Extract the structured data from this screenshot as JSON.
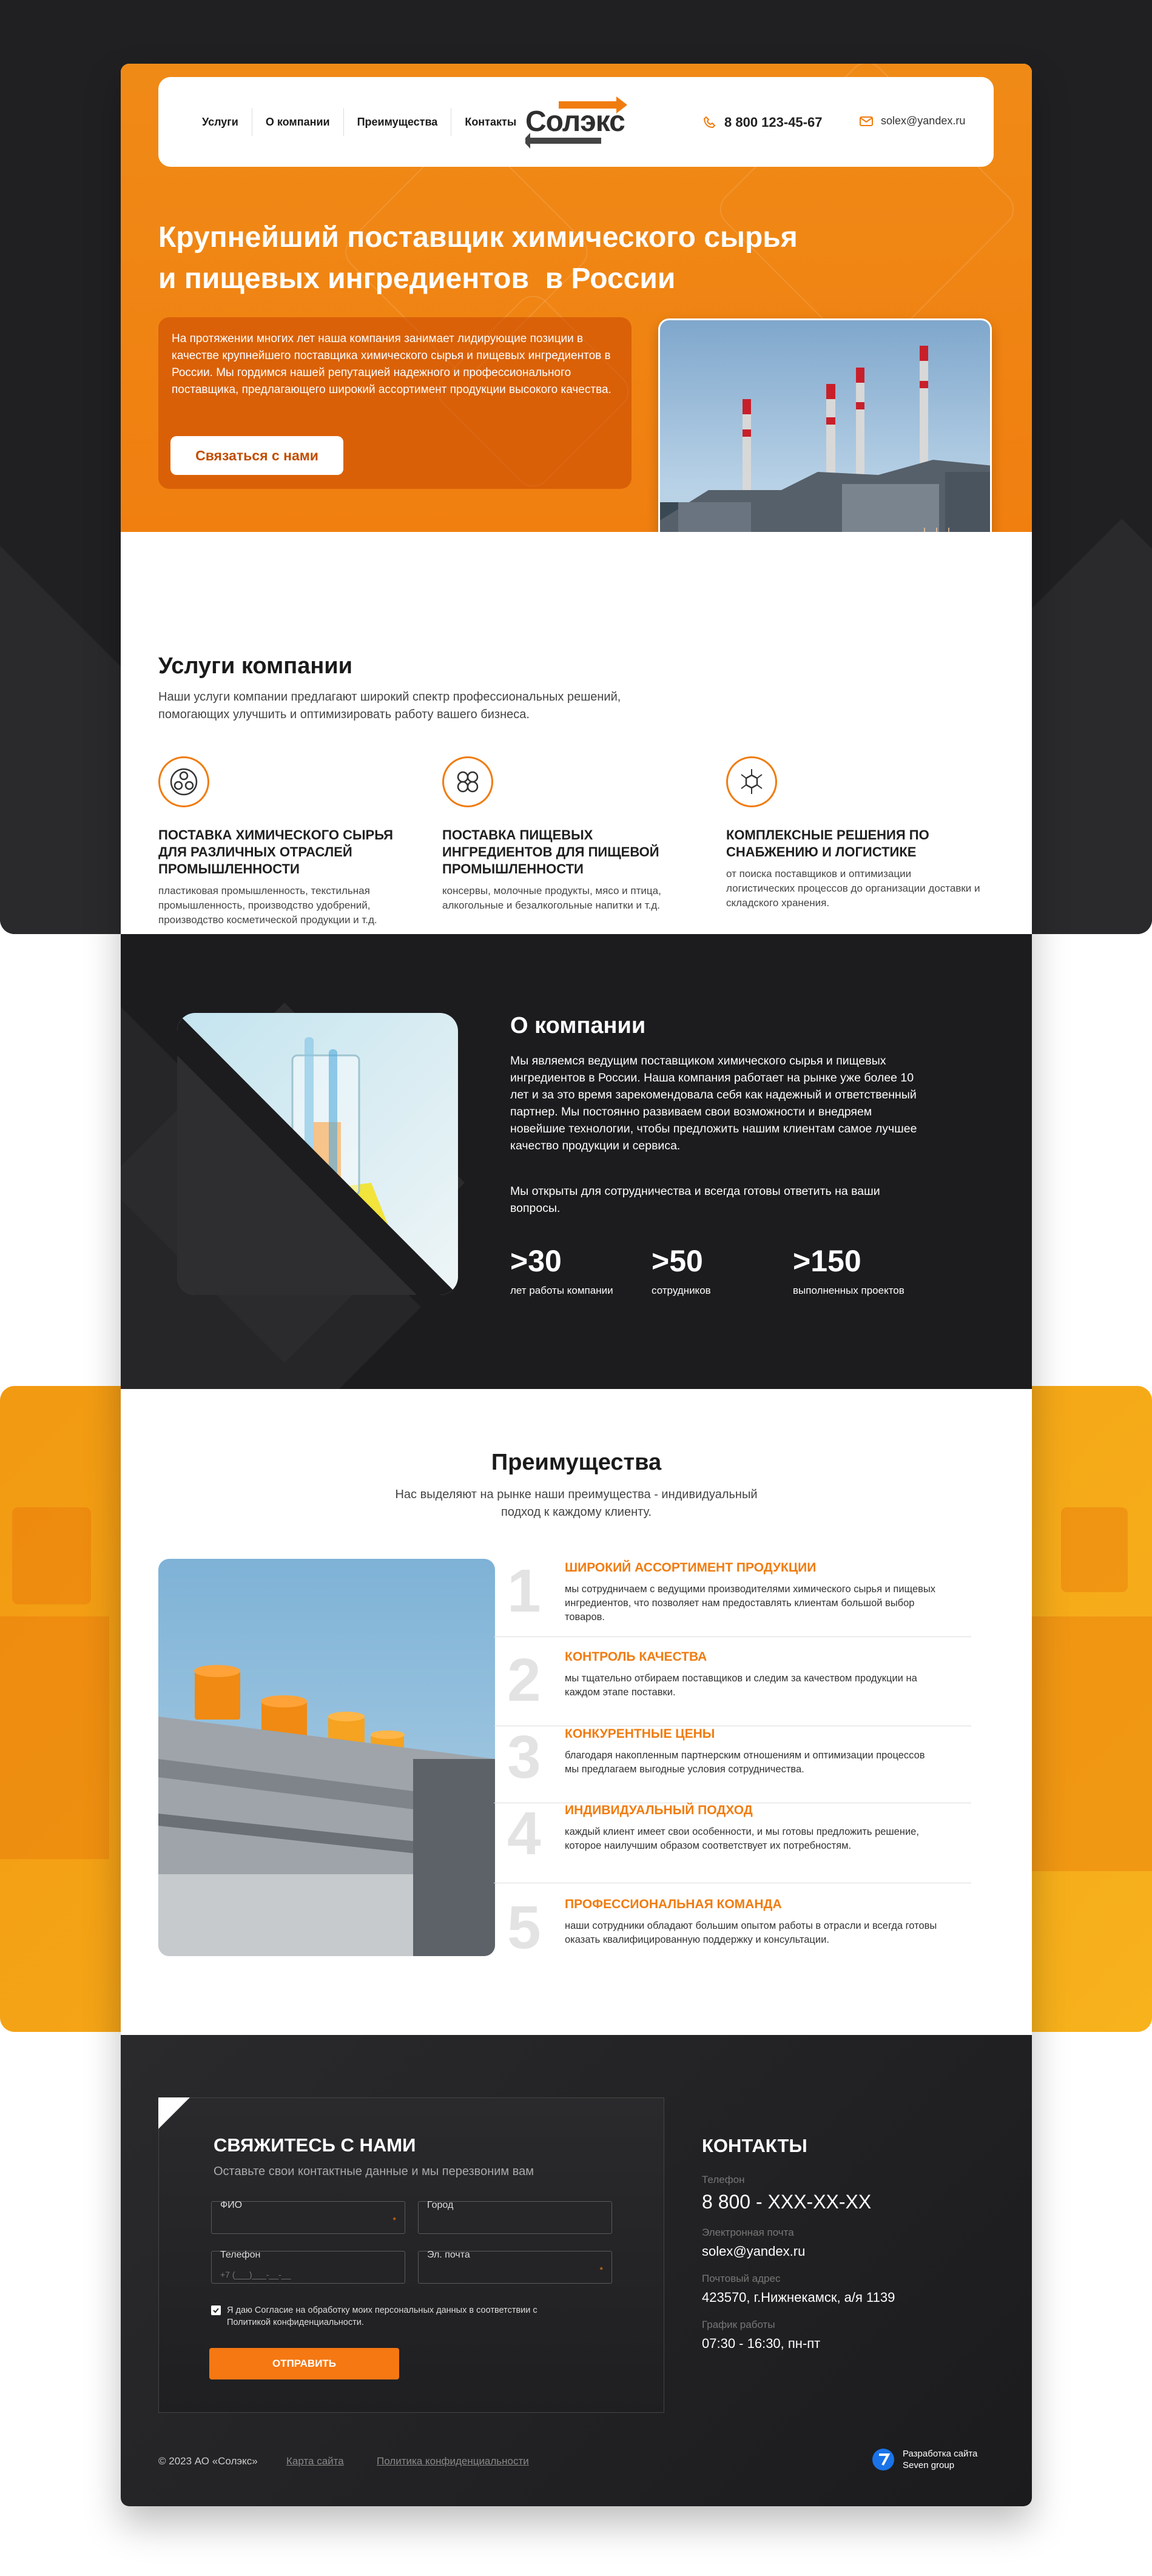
{
  "nav": {
    "items": [
      "Услуги",
      "О компании",
      "Преимущества",
      "Контакты"
    ],
    "logo": "Солэкс",
    "phone": "8 800 123-45-67",
    "email": "solex@yandex.ru"
  },
  "hero": {
    "title_line1": "Крупнейший поставщик химического сырья",
    "title_line2": "и пищевых ингредиентов  в России",
    "text": "На протяжении многих лет наша компания занимает лидирующие позиции в качестве крупнейшего поставщика химического сырья и пищевых ингредиентов в России. Мы гордимся нашей репутацией надежного и профессионального поставщика, предлагающего широкий ассортимент продукции высокого качества.",
    "button": "Связаться с нами"
  },
  "services": {
    "title": "Услуги компании",
    "subtitle": "Наши услуги компании предлагают широкий спектр профессиональных решений, помогающих улучшить и оптимизировать работу вашего бизнеса.",
    "items": [
      {
        "title": "ПОСТАВКА ХИМИЧЕСКОГО СЫРЬЯ ДЛЯ РАЗЛИЧНЫХ ОТРАСЛЕЙ ПРОМЫШЛЕННОСТИ",
        "text": "пластиковая промышленность, текстильная промышленность, производство удобрений, производство косметической продукции и т.д."
      },
      {
        "title": "ПОСТАВКА ПИЩЕВЫХ ИНГРЕДИЕНТОВ ДЛЯ ПИЩЕВОЙ ПРОМЫШЛЕННОСТИ",
        "text": "консервы, молочные продукты, мясо и птица, алкогольные и безалкогольные напитки и т.д."
      },
      {
        "title": "КОМПЛЕКСНЫЕ РЕШЕНИЯ ПО СНАБЖЕНИЮ И ЛОГИСТИКЕ",
        "text": "от поиска поставщиков и оптимизации логистических процессов до организации доставки и складского хранения."
      }
    ]
  },
  "about": {
    "title": "О компании",
    "p1": "Мы являемся ведущим поставщиком химического сырья и пищевых ингредиентов в России. Наша компания работает на рынке уже более 10 лет и за это время зарекомендовала себя как надежный и ответственный партнер. Мы постоянно развиваем свои возможности и внедряем новейшие технологии, чтобы предложить нашим клиентам самое лучшее качество продукции и сервиса.",
    "p2": "Мы открыты для сотрудничества и всегда готовы ответить на ваши вопросы.",
    "stats": [
      {
        "n": ">30",
        "l": "лет работы компании"
      },
      {
        "n": ">50",
        "l": "сотрудников"
      },
      {
        "n": ">150",
        "l": "выполненных проектов"
      }
    ]
  },
  "advantages": {
    "title": "Преимущества",
    "subtitle": "Нас выделяют на рынке наши преимущества - индивидуальный подход к каждому клиенту.",
    "items": [
      {
        "n": "1",
        "title": "ШИРОКИЙ АССОРТИМЕНТ ПРОДУКЦИИ",
        "text": "мы сотрудничаем с ведущими производителями химического сырья и пищевых ингредиентов, что позволяет нам предоставлять клиентам большой выбор товаров."
      },
      {
        "n": "2",
        "title": "КОНТРОЛЬ КАЧЕСТВА",
        "text": "мы тщательно отбираем поставщиков и следим за качеством продукции на каждом этапе поставки."
      },
      {
        "n": "3",
        "title": "КОНКУРЕНТНЫЕ ЦЕНЫ",
        "text": "благодаря накопленным партнерским отношениям и оптимизации процессов мы предлагаем выгодные условия сотрудничества."
      },
      {
        "n": "4",
        "title": "ИНДИВИДУАЛЬНЫЙ ПОДХОД",
        "text": "каждый клиент имеет свои особенности, и мы готовы предложить решение, которое наилучшим образом соответствует их потребностям."
      },
      {
        "n": "5",
        "title": "ПРОФЕССИОНАЛЬНАЯ КОМАНДА",
        "text": "наши сотрудники обладают большим опытом работы в отрасли и всегда готовы оказать квалифицированную поддержку и консультации."
      }
    ]
  },
  "form": {
    "title": "СВЯЖИТЕСЬ С НАМИ",
    "subtitle": "Оставьте свои контактные данные и мы перезвоним вам",
    "fio": "ФИО",
    "city": "Город",
    "phone": "Телефон",
    "phone_placeholder": "+7 (___)___-__-__",
    "email": "Эл. почта",
    "consent": "Я даю Согласие на обработку моих персональных данных в соответствии с Политикой конфиденциальности.",
    "submit": "ОТПРАВИТЬ"
  },
  "contacts": {
    "title": "КОНТАКТЫ",
    "phone_label": "Телефон",
    "phone": "8 800 - XXX-XX-XX",
    "email_label": "Электронная почта",
    "email": "solex@yandex.ru",
    "address_label": "Почтовый адрес",
    "address": "423570, г.Нижнекамск, а/я 1139",
    "hours_label": "График работы",
    "hours": "07:30 - 16:30, пн-пт"
  },
  "footer": {
    "copyright": "© 2023 АО «Солэкс»",
    "sitemap": "Карта сайта",
    "privacy": "Политика конфиденциальности",
    "dev_line1": "Разработка сайта",
    "dev_line2": "Seven group"
  }
}
